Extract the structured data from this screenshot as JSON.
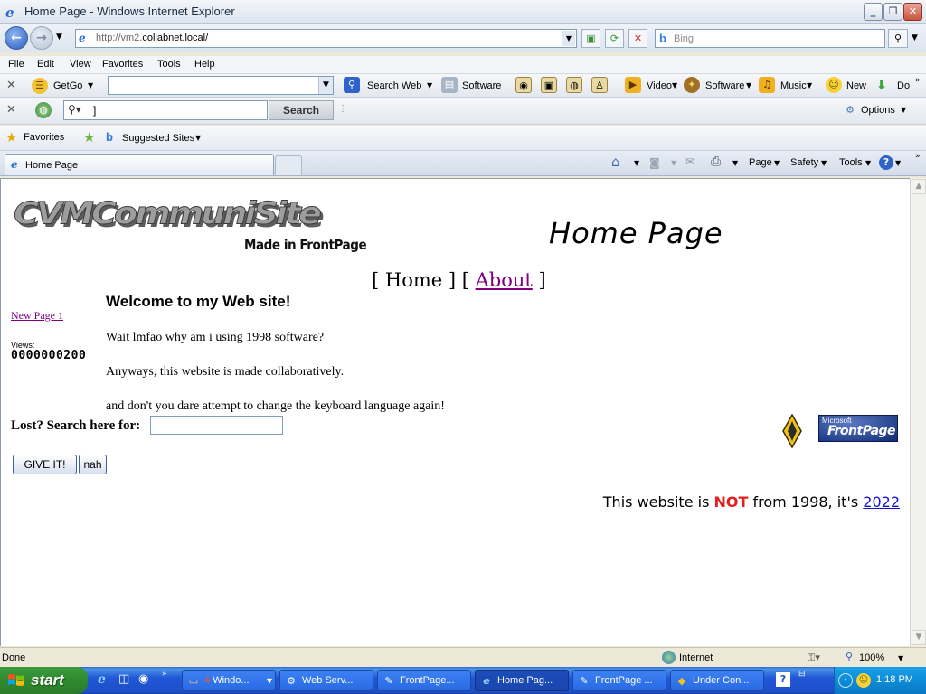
{
  "window": {
    "title": "Home Page - Windows Internet Explorer"
  },
  "address_bar": {
    "url_prefix": "http://vm2.",
    "url_host": "collabnet.local/",
    "search_placeholder": "Bing"
  },
  "menu": {
    "items": [
      "File",
      "Edit",
      "View",
      "Favorites",
      "Tools",
      "Help"
    ]
  },
  "toolbar_getgo": {
    "getgo_label": "GetGo",
    "search_web_label": "Search Web",
    "software_label": "Software",
    "video_label": "Video",
    "software2_label": "Software",
    "music_label": "Music",
    "new_label": "New",
    "download_label": "Do"
  },
  "toolbar_search": {
    "query": "]",
    "search_button": "Search",
    "options_label": "Options"
  },
  "favorites_bar": {
    "favorites_label": "Favorites",
    "suggested_label": "Suggested Sites"
  },
  "tabs": {
    "active_tab_label": "Home Page"
  },
  "command_bar": {
    "page_label": "Page",
    "safety_label": "Safety",
    "tools_label": "Tools"
  },
  "page": {
    "logo_text": "CVMCommuniSite",
    "logo_subtext": "Made in FrontPage",
    "heading": "Home Page",
    "nav_home": "Home",
    "nav_about": "About",
    "welcome": "Welcome to my Web site!",
    "sidebar_link": "New Page 1",
    "views_label": "Views:",
    "views_count": "0000000200",
    "paragraph1": "Wait lmfao why am i using 1998 software?",
    "paragraph2": "Anyways, this website is made collaboratively.",
    "paragraph3": "and don't you dare attempt to change the keyboard language again!",
    "search_prompt": "Lost? Search here for:",
    "search_value": "",
    "submit_button": "GIVE IT!",
    "reset_button": "nah",
    "badge_small": "Microsoft",
    "badge_large": "FrontPage",
    "footer_pre": "This website is",
    "footer_not": "NOT",
    "footer_mid": "from 1998, it's",
    "footer_year": "2022"
  },
  "status_bar": {
    "status": "Done",
    "zone": "Internet",
    "zoom": "100%"
  },
  "taskbar": {
    "start_label": "start",
    "tasks": [
      {
        "label": "Windo...",
        "count": "4"
      },
      {
        "label": "Web Serv..."
      },
      {
        "label": "FrontPage..."
      },
      {
        "label": "Home Pag..."
      },
      {
        "label": "FrontPage ..."
      },
      {
        "label": "Under Con..."
      }
    ],
    "clock": "1:18 PM"
  },
  "colors": {
    "visited_link": "#800080",
    "footer_not": "#E3201B",
    "footer_year": "#1515C8"
  }
}
